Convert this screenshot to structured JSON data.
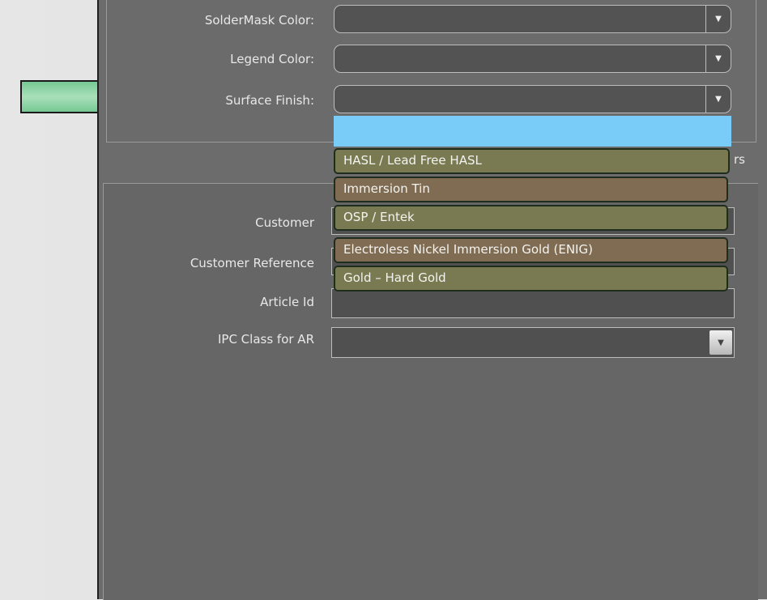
{
  "fields": {
    "soldermask_label": "SolderMask Color:",
    "legend_label": "Legend Color:",
    "surface_label": "Surface Finish:",
    "customer_label": "Customer",
    "customer_ref_label": "Customer Reference",
    "article_label": "Article Id",
    "ipc_label": "IPC Class for AR"
  },
  "surface_finish_options": [
    "HASL / Lead Free HASL",
    "Immersion Tin",
    "OSP / Entek",
    "Electroless Nickel Immersion Gold (ENIG)",
    "Gold – Hard Gold"
  ],
  "partial_text": "rs",
  "icons": {
    "dropdown": "▼",
    "annotation": "arrow-right-icon"
  },
  "colors": {
    "highlight": "#79ccf8",
    "option_olive": "#7a7a52",
    "option_brown": "#806c52",
    "arrow_green": "#3fae6b"
  }
}
